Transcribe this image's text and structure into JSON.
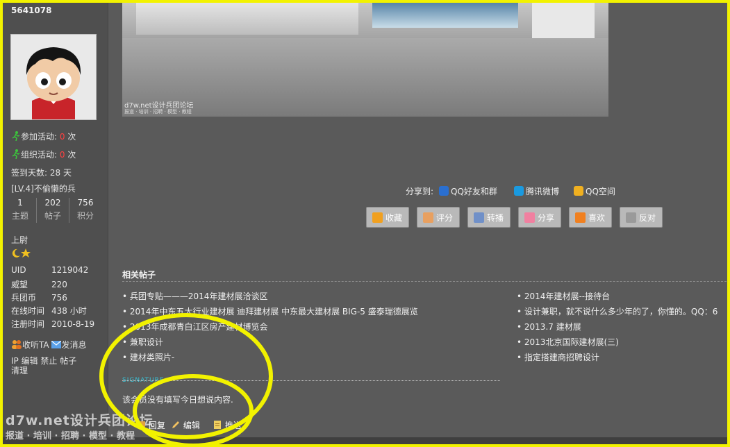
{
  "profile": {
    "uid_header": "5641078",
    "activities_joined_label": "参加活动:",
    "activities_joined_value": "0",
    "activities_organized_label": "组织活动:",
    "activities_organized_value": "0",
    "times_unit": "次",
    "checkin": "签到天数: 28 天",
    "level": "[LV.4]不偷懒的兵",
    "stats": [
      {
        "num": "1",
        "label": "主题"
      },
      {
        "num": "202",
        "label": "帖子"
      },
      {
        "num": "756",
        "label": "积分"
      }
    ],
    "rank": "上尉",
    "info": [
      {
        "k": "UID",
        "v": "1219042"
      },
      {
        "k": "威望",
        "v": "220"
      },
      {
        "k": "兵团币",
        "v": "756"
      },
      {
        "k": "在线时间",
        "v": "438 小时"
      },
      {
        "k": "注册时间",
        "v": "2010-8-19"
      }
    ],
    "listen_label": "收听TA",
    "message_label": "发消息",
    "admin_links": "IP 编辑 禁止 帖子",
    "admin_links2": "清理"
  },
  "photo": {
    "watermark": "d7w.net设计兵团论坛",
    "watermark_sub": "报道 · 培训 · 招聘 · 模型 · 教程"
  },
  "share": {
    "label": "分享到:",
    "targets": [
      "QQ好友和群",
      "腾讯微博",
      "QQ空间"
    ]
  },
  "actions": [
    "收藏",
    "评分",
    "转播",
    "分享",
    "喜欢",
    "反对"
  ],
  "related": {
    "title": "相关帖子",
    "left": [
      "兵团专贴———2014年建材展洽谈区",
      "2014年中东五大行业建材展 迪拜建材展 中东最大建材展 BIG-5 盛泰瑞德展览",
      "2013年成都青白江区房产建材博览会",
      "兼职设计",
      "建材类照片-"
    ],
    "right": [
      "2014年建材展--接待台",
      "设计兼职，就不说什么多少年的了，你懂的。QQ：6",
      "2013.7 建材展",
      "2013北京国际建材展(三)",
      "指定搭建商招聘设计"
    ]
  },
  "signature": {
    "label": "SIGNATURE",
    "text": "该会员没有填写今日想说内容."
  },
  "footer": {
    "buttons": [
      "回复",
      "编辑",
      "推送"
    ],
    "watermark": "d7w.net设计兵团论坛",
    "watermark_sub": "报道 · 培训 · 招聘 · 模型 · 教程"
  },
  "colors": {
    "annotation": "#f2f200",
    "signature": "#39c2d7",
    "zero_value": "#ff4040"
  }
}
